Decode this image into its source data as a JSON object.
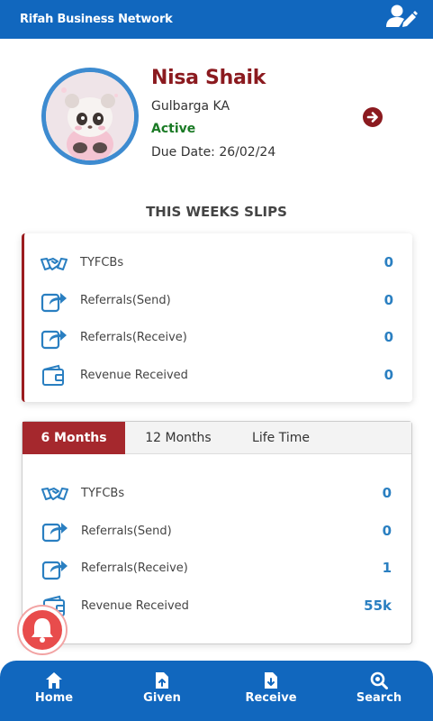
{
  "app": {
    "title": "Rifah Business Network"
  },
  "profile": {
    "name": "Nisa Shaik",
    "location": "Gulbarga KA",
    "status": "Active",
    "due_date": "Due Date: 26/02/24"
  },
  "weekly": {
    "title": "THIS WEEKS SLIPS",
    "rows": [
      {
        "label": "TYFCBs",
        "value": "0",
        "icon": "handshake-icon"
      },
      {
        "label": "Referrals(Send)",
        "value": "0",
        "icon": "share-icon"
      },
      {
        "label": "Referrals(Receive)",
        "value": "0",
        "icon": "share-icon"
      },
      {
        "label": "Revenue Received",
        "value": "0",
        "icon": "wallet-icon"
      }
    ]
  },
  "period": {
    "tabs": [
      "6 Months",
      "12 Months",
      "Life Time"
    ],
    "active_tab": "6 Months",
    "rows": [
      {
        "label": "TYFCBs",
        "value": "0",
        "icon": "handshake-icon"
      },
      {
        "label": "Referrals(Send)",
        "value": "0",
        "icon": "share-icon"
      },
      {
        "label": "Referrals(Receive)",
        "value": "1",
        "icon": "share-icon"
      },
      {
        "label": "Revenue Received",
        "value": "55k",
        "icon": "wallet-icon"
      }
    ]
  },
  "nav": {
    "items": [
      {
        "label": "Home",
        "icon": "home-icon"
      },
      {
        "label": "Given",
        "icon": "file-upload-icon"
      },
      {
        "label": "Receive",
        "icon": "file-download-icon"
      },
      {
        "label": "Search",
        "icon": "search-icon"
      }
    ]
  },
  "colors": {
    "primary": "#1167be",
    "accent_red": "#8b1a1f",
    "status_green": "#1a7a25",
    "value_blue": "#2a7fc1",
    "notification_red": "#e84c4c"
  }
}
